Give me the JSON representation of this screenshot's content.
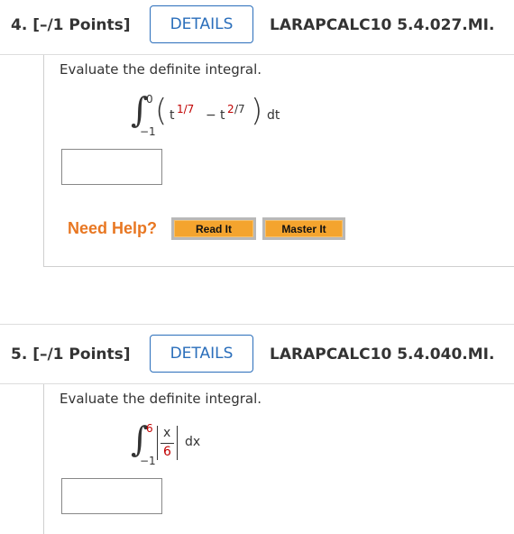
{
  "q4": {
    "number": "4.  [–/1 Points]",
    "details": "DETAILS",
    "code": "LARAPCALC10 5.4.027.MI.",
    "prompt": "Evaluate the definite integral.",
    "integral": {
      "upper": "0",
      "lower": "−1",
      "t": "t",
      "exp1": "1/7",
      "minus": "−",
      "t2": "t",
      "exp2_num": "2",
      "exp2_den": "/7",
      "dt": "dt"
    },
    "need_help": "Need Help?",
    "read_it": "Read It",
    "master_it": "Master It"
  },
  "q5": {
    "number": "5.  [–/1 Points]",
    "details": "DETAILS",
    "code": "LARAPCALC10 5.4.040.MI.",
    "prompt": "Evaluate the definite integral.",
    "integral": {
      "upper": "6",
      "lower": "−1",
      "num": "x",
      "den": "6",
      "dx": "dx"
    }
  }
}
